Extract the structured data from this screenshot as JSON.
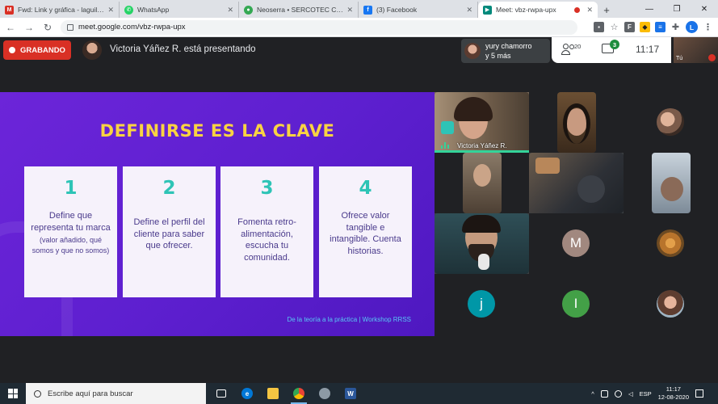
{
  "browser": {
    "tabs": [
      {
        "title": "Fwd: Link y gráfica - laguilera@...",
        "icon": "gmail-icon",
        "color": "#d93025"
      },
      {
        "title": "WhatsApp",
        "icon": "whatsapp-icon",
        "color": "#25d366"
      },
      {
        "title": "Neoserra • SERCOTEC Chile",
        "icon": "neoserra-icon",
        "color": "#34a853"
      },
      {
        "title": "(3) Facebook",
        "icon": "facebook-icon",
        "color": "#1877f2"
      },
      {
        "title": "Meet: vbz-rwpa-upx",
        "icon": "meet-icon",
        "color": "#00897b"
      }
    ],
    "new_tab": "+",
    "url": "meet.google.com/vbz-rwpa-upx",
    "profile_initial": "L"
  },
  "meet": {
    "recording_label": "GRABANDO",
    "presenter_text": "Victoria Yáñez R. está presentando",
    "join_chip": {
      "line1": "yury chamorro",
      "line2": "y 5 más"
    },
    "people_count": "20",
    "chat_badge": "3",
    "clock": "11:17",
    "self_label": "Tú"
  },
  "slide": {
    "title": "DEFINIRSE ES LA CLAVE",
    "cards": [
      {
        "num": "1",
        "text": "Define que representa tu marca",
        "note": "(valor añadido, qué somos y que no somos)"
      },
      {
        "num": "2",
        "text": "Define el perfil del cliente para saber que ofrecer.",
        "note": ""
      },
      {
        "num": "3",
        "text": "Fomenta retro-alimentación, escucha tu comunidad.",
        "note": ""
      },
      {
        "num": "4",
        "text": "Ofrece valor tangible e intangible. Cuenta historias.",
        "note": ""
      }
    ],
    "footer": "De la teoría a la práctica | Workshop RRSS"
  },
  "participants": {
    "presenter_name": "Victoria Yáñez R.",
    "avatar_m": "M",
    "avatar_j": "j",
    "avatar_i": "I",
    "colors": {
      "m": "#a1887f",
      "j": "#0097a7",
      "i": "#43a047"
    }
  },
  "taskbar": {
    "search_placeholder": "Escribe aquí para buscar",
    "language": "ESP",
    "time": "11:17",
    "date": "12-08-2020"
  }
}
